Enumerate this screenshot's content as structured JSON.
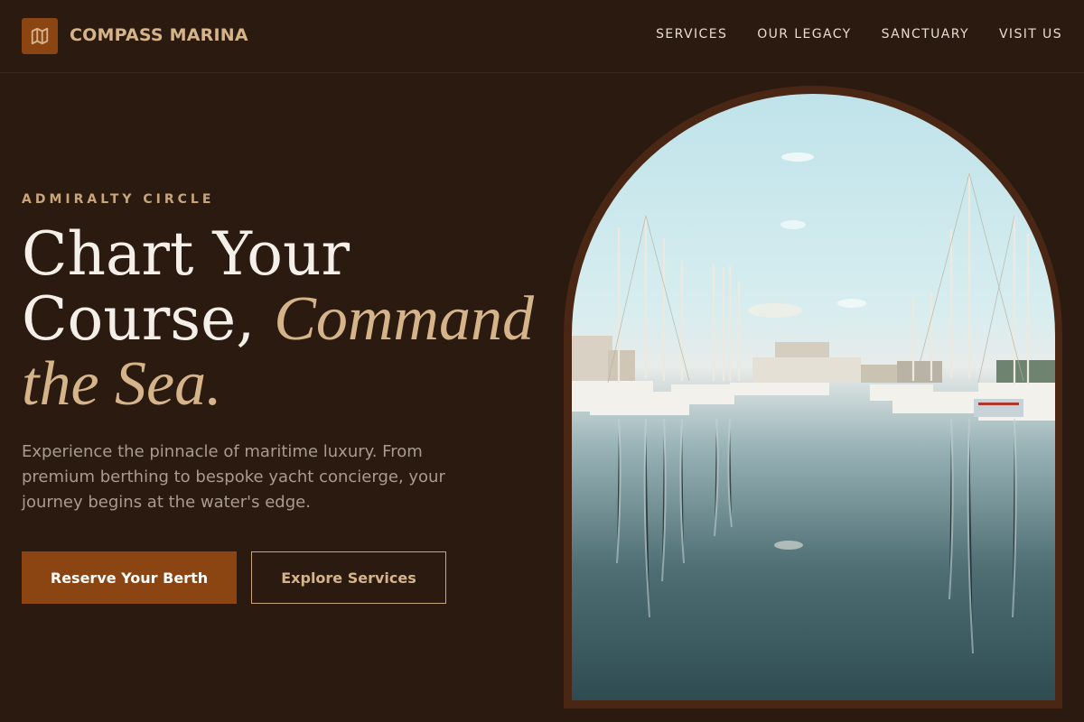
{
  "header": {
    "brand": "COMPASS MARINA",
    "logo_icon": "map-icon",
    "nav": [
      {
        "label": "SERVICES"
      },
      {
        "label": "OUR LEGACY"
      },
      {
        "label": "SANCTUARY"
      },
      {
        "label": "VISIT US"
      }
    ]
  },
  "hero": {
    "eyebrow": "ADMIRALTY CIRCLE",
    "headline_line1": "Chart Your",
    "headline_line2_plain": "Course,",
    "headline_line2_accent": "Command",
    "headline_line3_accent": "the Sea.",
    "description": "Experience the pinnacle of maritime luxury. From premium berthing to bespoke yacht concierge, your journey begins at the water's edge.",
    "primary_cta": "Reserve Your Berth",
    "secondary_cta": "Explore Services",
    "image_subject": "marina-sailboats-reflection"
  },
  "colors": {
    "background": "#2b1a10",
    "accent_brown": "#8b4513",
    "gold": "#d6b48a",
    "text_light": "#f4efe8",
    "text_muted": "#a89b8f"
  }
}
